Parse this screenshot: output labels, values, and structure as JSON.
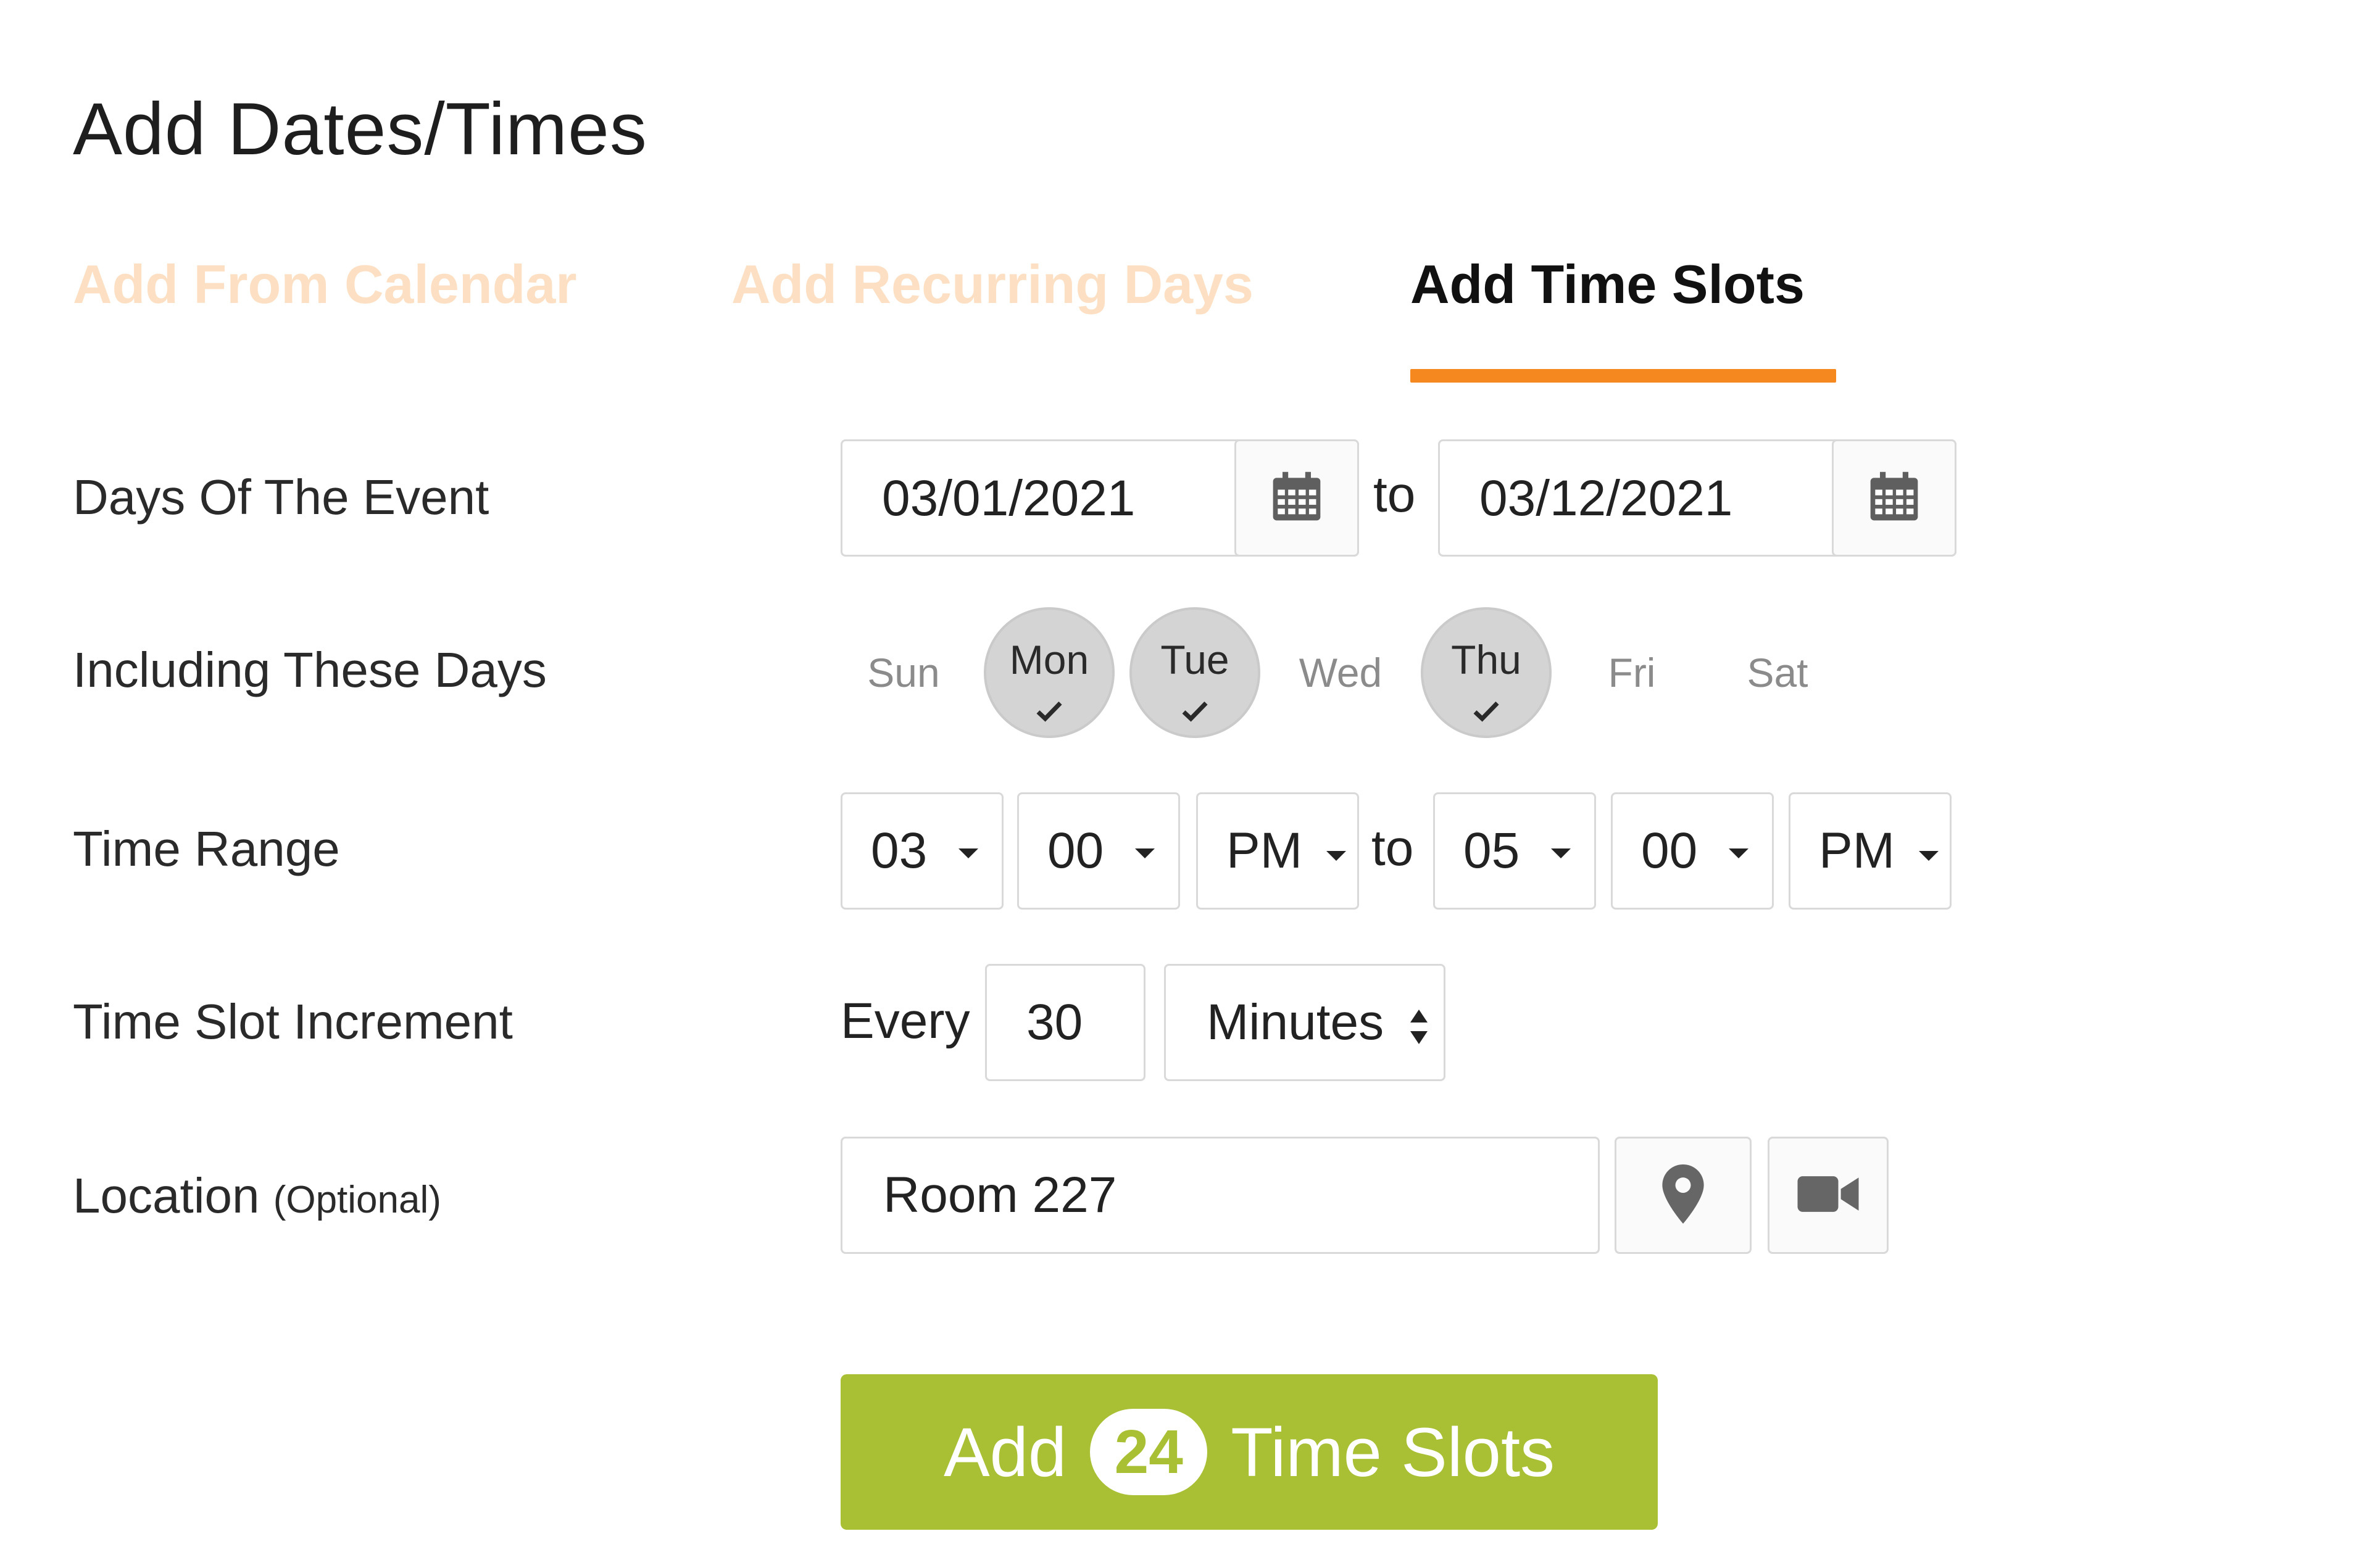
{
  "title": "Add Dates/Times",
  "tabs": [
    {
      "label": "Add From Calendar",
      "active": false
    },
    {
      "label": "Add Recurring Days",
      "active": false
    },
    {
      "label": "Add Time Slots",
      "active": true
    }
  ],
  "colors": {
    "accent_orange": "#f5891f",
    "inactive_tab": "#fde0c4",
    "button_green": "#a9c034",
    "selected_day_bg": "#d4d4d4"
  },
  "days_of_event": {
    "label": "Days Of The Event",
    "start_date": "03/01/2021",
    "to": "to",
    "end_date": "03/12/2021",
    "calendar_icon": "calendar-icon"
  },
  "including_days": {
    "label": "Including These Days",
    "days": [
      {
        "name": "Sun",
        "selected": false
      },
      {
        "name": "Mon",
        "selected": true
      },
      {
        "name": "Tue",
        "selected": true
      },
      {
        "name": "Wed",
        "selected": false
      },
      {
        "name": "Thu",
        "selected": true
      },
      {
        "name": "Fri",
        "selected": false
      },
      {
        "name": "Sat",
        "selected": false
      }
    ]
  },
  "time_range": {
    "label": "Time Range",
    "start_hour": "03",
    "start_minute": "00",
    "start_ampm": "PM",
    "to": "to",
    "end_hour": "05",
    "end_minute": "00",
    "end_ampm": "PM"
  },
  "increment": {
    "label": "Time Slot Increment",
    "every": "Every",
    "value": "30",
    "unit": "Minutes"
  },
  "location": {
    "label": "Location",
    "optional": "(Optional)",
    "value": "Room 227",
    "pin_icon": "map-pin-icon",
    "video_icon": "video-camera-icon"
  },
  "submit": {
    "prefix": "Add",
    "count": "24",
    "suffix": "Time Slots"
  }
}
